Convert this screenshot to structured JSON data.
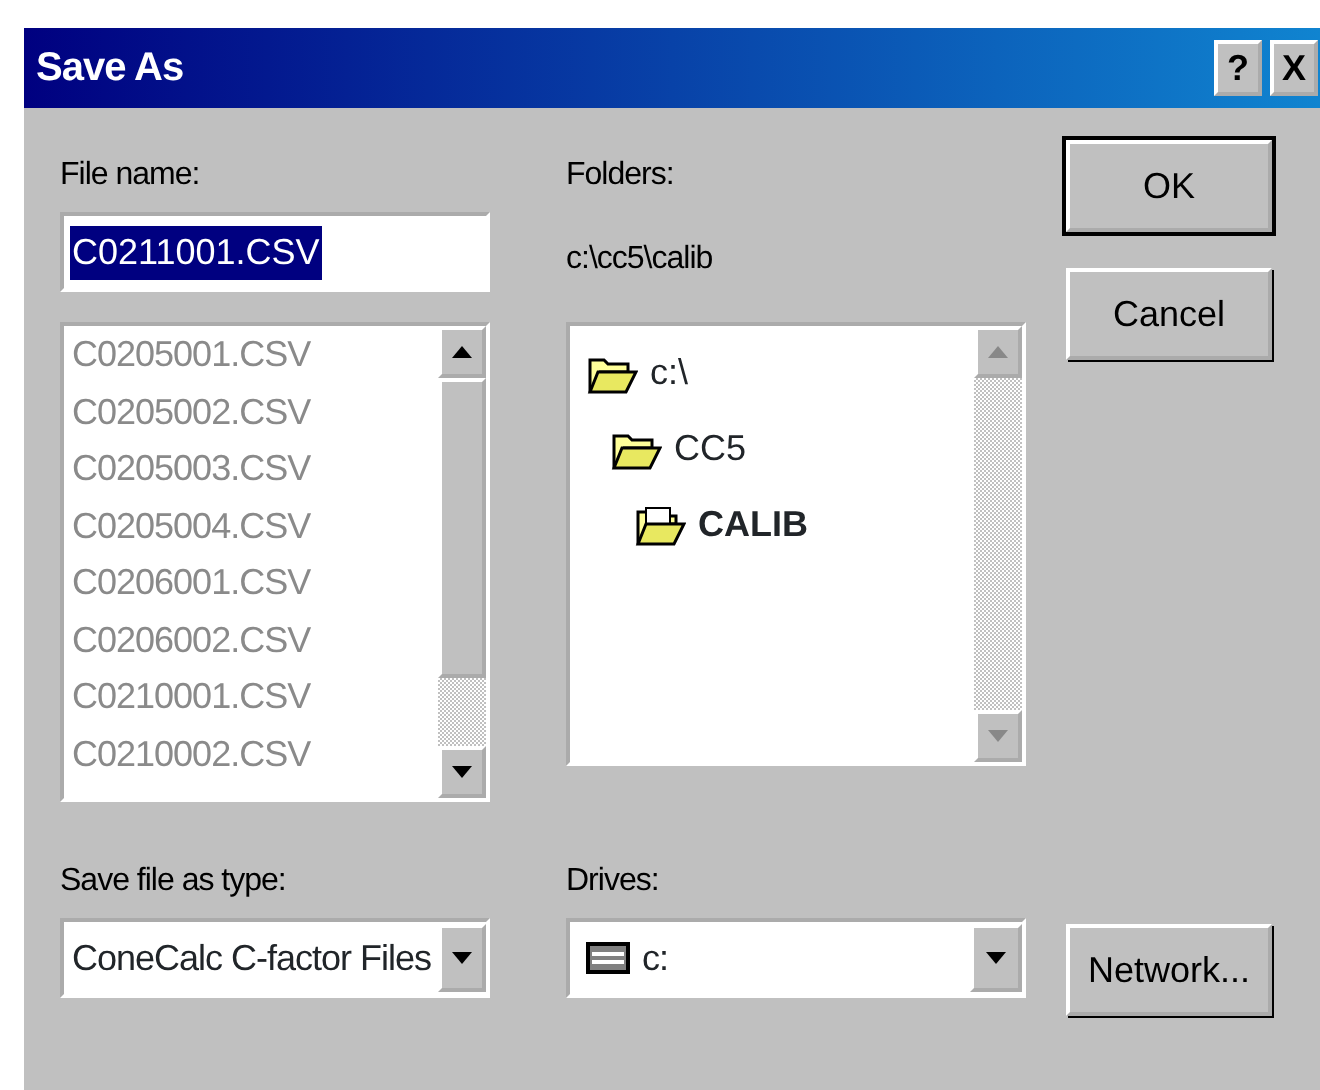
{
  "window": {
    "title": "Save As",
    "title_buttons": [
      "?",
      "X"
    ]
  },
  "file_name": {
    "label": "File name:",
    "value": "C0211001.CSV",
    "selected": true
  },
  "file_list": {
    "disabled": true,
    "items": [
      "C0205001.CSV",
      "C0205002.CSV",
      "C0205003.CSV",
      "C0205004.CSV",
      "C0206001.CSV",
      "C0206002.CSV",
      "C0210001.CSV",
      "C0210002.CSV"
    ]
  },
  "folders": {
    "label": "Folders:",
    "path": "c:\\cc5\\calib",
    "tree": [
      {
        "name": "c:\\",
        "selected": false,
        "children": [
          {
            "name": "CC5",
            "selected": false,
            "children": [
              {
                "name": "CALIB",
                "selected": true
              }
            ]
          }
        ]
      }
    ]
  },
  "file_type": {
    "label": "Save file as type:",
    "value": "ConeCalc C-factor Files"
  },
  "drives": {
    "label": "Drives:",
    "value": "c:"
  },
  "buttons": [
    {
      "label": "OK",
      "default": true
    },
    {
      "label": "Cancel",
      "default": false
    },
    {
      "label": "Network...",
      "default": false
    }
  ]
}
